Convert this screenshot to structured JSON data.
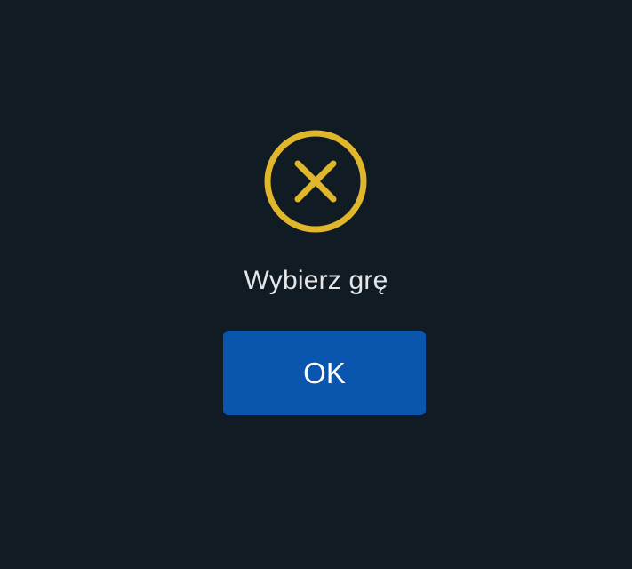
{
  "dialog": {
    "icon": "error-x-circle-icon",
    "icon_color": "#e0b62a",
    "message": "Wybierz grę",
    "ok_label": "OK",
    "button_color": "#0a56ae",
    "background_color": "#101b24"
  }
}
